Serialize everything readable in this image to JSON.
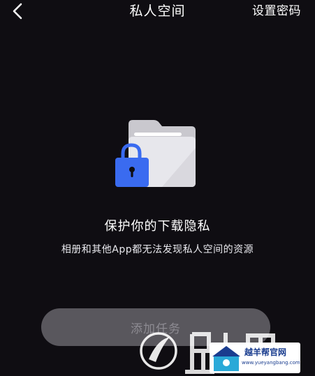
{
  "header": {
    "title": "私人空间",
    "action_label": "设置密码",
    "back_icon": "chevron-left-icon"
  },
  "illustration": {
    "icons": [
      "folder-icon",
      "lock-icon"
    ],
    "colors": {
      "folder_back": "#c9c8ce",
      "folder_front": "#e7e7ec",
      "lock_body": "#3a6bf0"
    }
  },
  "main": {
    "headline": "保护你的下载隐私",
    "description": "相册和其他App都无法发现私人空间的资源"
  },
  "button": {
    "label": "添加任务",
    "state": "disabled"
  },
  "watermark": {
    "site_name": "越羊帮官网",
    "site_url": "www.yueyangbang.com"
  },
  "colors": {
    "background": "#0f0d12",
    "text": "#ffffff",
    "button_bg": "#59575d",
    "button_text": "#8d8b92"
  }
}
